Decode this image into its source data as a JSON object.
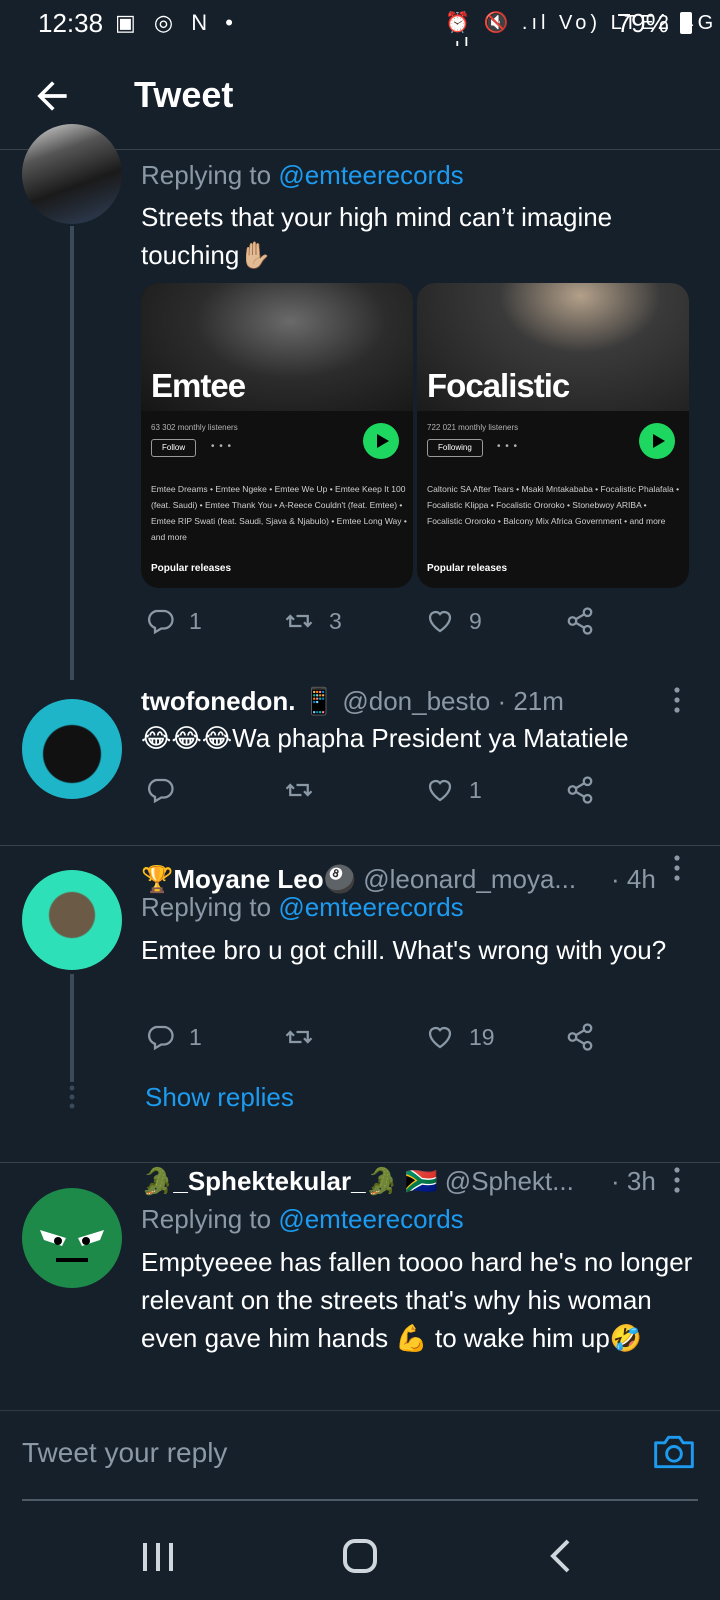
{
  "status_bar": {
    "time": "12:38",
    "left_icons": "▣ ◎ N •",
    "mid_icons": "⏰ 🔇 .ıl Vo) LTE2 4G .ıl",
    "battery": "79%"
  },
  "header": {
    "title": "Tweet"
  },
  "tweets": [
    {
      "replying_prefix": "Replying to",
      "replying_handle": "@emteerecords",
      "text": "Streets that your high mind can’t imagine touching✋🏼",
      "cards": [
        {
          "artist": "Emtee",
          "listeners": "63 302 monthly listeners",
          "follow": "Follow",
          "dots": "• • •",
          "tracks": "Emtee Dreams  •  Emtee Ngeke  •  Emtee We Up  •  Emtee Keep It 100 (feat. Saudi)  •  Emtee Thank You  •  A-Reece Couldn't (feat. Emtee)  •  Emtee RIP Swati (feat. Saudi, Sjava & Njabulo)  •  Emtee Long Way  •  and more",
          "popular": "Popular releases"
        },
        {
          "artist": "Focalistic",
          "listeners": "722 021 monthly listeners",
          "follow": "Following",
          "dots": "• • •",
          "tracks": "Caltonic SA After Tears  •  Msaki Mntakababa  •  Focalistic Phalafala  •  Focalistic Klippa  •  Focalistic Ororoko  •  Stonebwoy ARIBA  •  Focalistic Ororoko  •  Balcony Mix Africa Government  •  and more",
          "popular": "Popular releases"
        }
      ],
      "replies": "1",
      "retweets": "3",
      "likes": "9"
    },
    {
      "name": "twofonedon. 📱",
      "handle": "@don_besto",
      "time": "· 21m",
      "text": "😂😂😂Wa phapha President ya Matatiele",
      "replies": "",
      "retweets": "",
      "likes": "1"
    },
    {
      "name": "🏆Moyane Leo🎱",
      "handle": "@leonard_moya...",
      "time": "· 4h",
      "replying_prefix": "Replying to",
      "replying_handle": "@emteerecords",
      "text": "Emtee bro u got chill. What's wrong with you?",
      "replies": "1",
      "retweets": "",
      "likes": "19",
      "show_replies": "Show replies"
    },
    {
      "name": "🐊_Sphektekular_🐊 🇿🇦",
      "handle": "@Sphekt...",
      "time": "· 3h",
      "replying_prefix": "Replying to",
      "replying_handle": "@emteerecords",
      "text": "Emptyeeee has fallen toooo hard he's no longer relevant on the streets that's why his woman even gave him hands 💪 to wake him up🤣"
    }
  ],
  "reply_bar": {
    "placeholder": "Tweet your reply"
  },
  "colors": {
    "background": "#15202b",
    "accent": "#1d9bf0",
    "muted": "#8b98a5",
    "divider": "#38444d"
  }
}
